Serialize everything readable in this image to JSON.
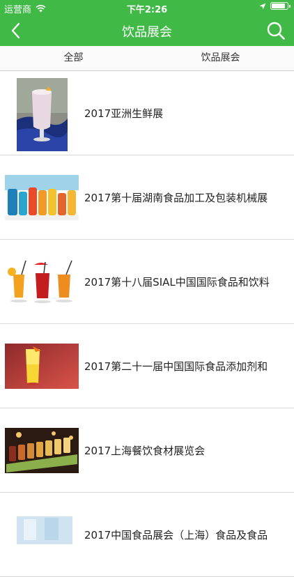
{
  "status_bar": {
    "carrier": "运营商",
    "time": "下午2:26"
  },
  "nav": {
    "title": "饮品展会",
    "back_icon": "chevron-left-icon",
    "search_icon": "search-icon",
    "bg_color": "#41b947"
  },
  "tabs": [
    {
      "label": "全部"
    },
    {
      "label": "饮品展会"
    }
  ],
  "items": [
    {
      "title": "2017亚洲生鲜展"
    },
    {
      "title": "2017第十届湖南食品加工及包装机械展"
    },
    {
      "title": "2017第十八届SIAL中国国际食品和饮料"
    },
    {
      "title": "2017第二十一届中国国际食品添加剂和"
    },
    {
      "title": "2017上海餐饮食材展览会"
    },
    {
      "title": "2017中国食品展会（上海）食品及食品"
    }
  ]
}
